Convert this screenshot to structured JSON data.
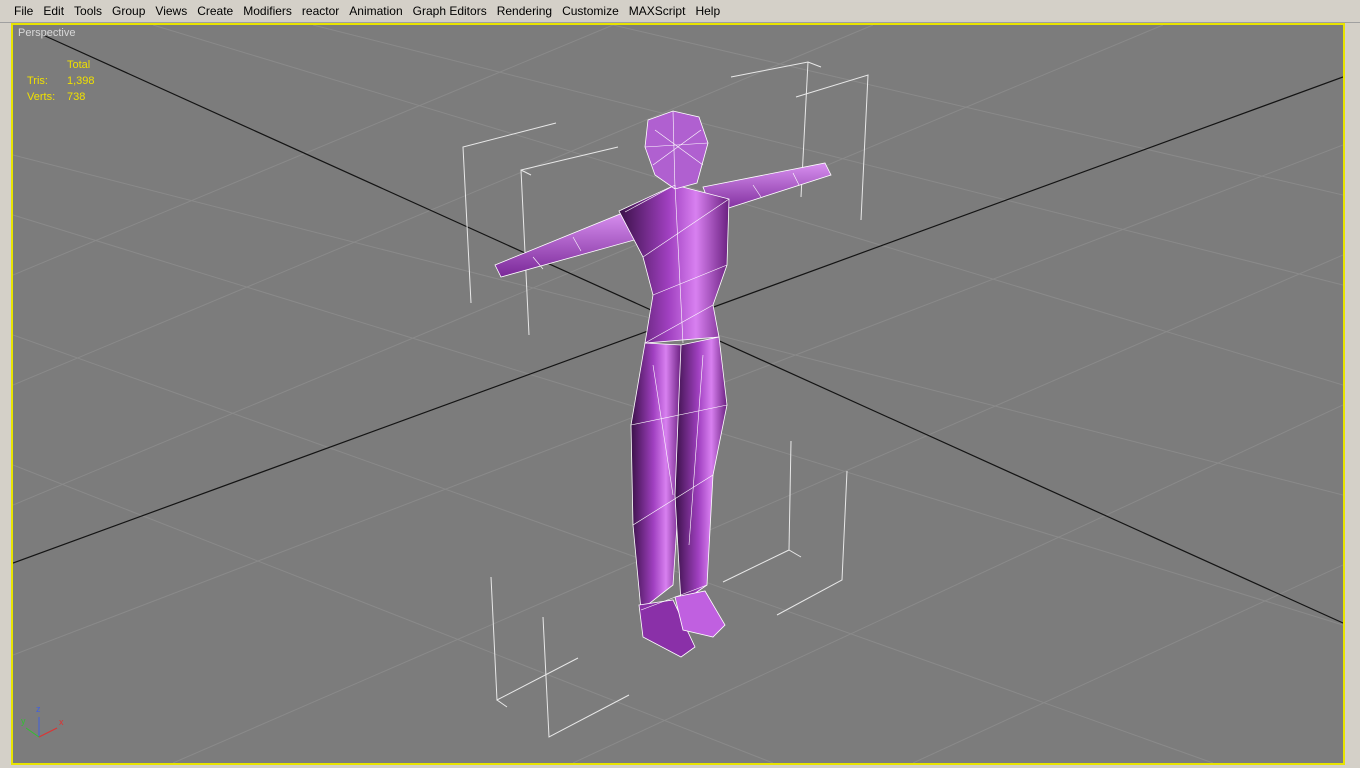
{
  "menu": {
    "items": [
      {
        "label": "File"
      },
      {
        "label": "Edit"
      },
      {
        "label": "Tools"
      },
      {
        "label": "Group"
      },
      {
        "label": "Views"
      },
      {
        "label": "Create"
      },
      {
        "label": "Modifiers"
      },
      {
        "label": "reactor"
      },
      {
        "label": "Animation"
      },
      {
        "label": "Graph Editors"
      },
      {
        "label": "Rendering"
      },
      {
        "label": "Customize"
      },
      {
        "label": "MAXScript"
      },
      {
        "label": "Help"
      }
    ]
  },
  "viewport": {
    "label": "Perspective",
    "active_border_color": "#e8e400",
    "background_color": "#7c7c7c",
    "model_color": "#a040c0",
    "wire_color": "#ffffff"
  },
  "stats": {
    "header": "Total",
    "tris_label": "Tris:",
    "tris_value": "1,398",
    "verts_label": "Verts:",
    "verts_value": "738"
  },
  "axis_gizmo": {
    "z": "z",
    "y": "y",
    "x": "x"
  }
}
